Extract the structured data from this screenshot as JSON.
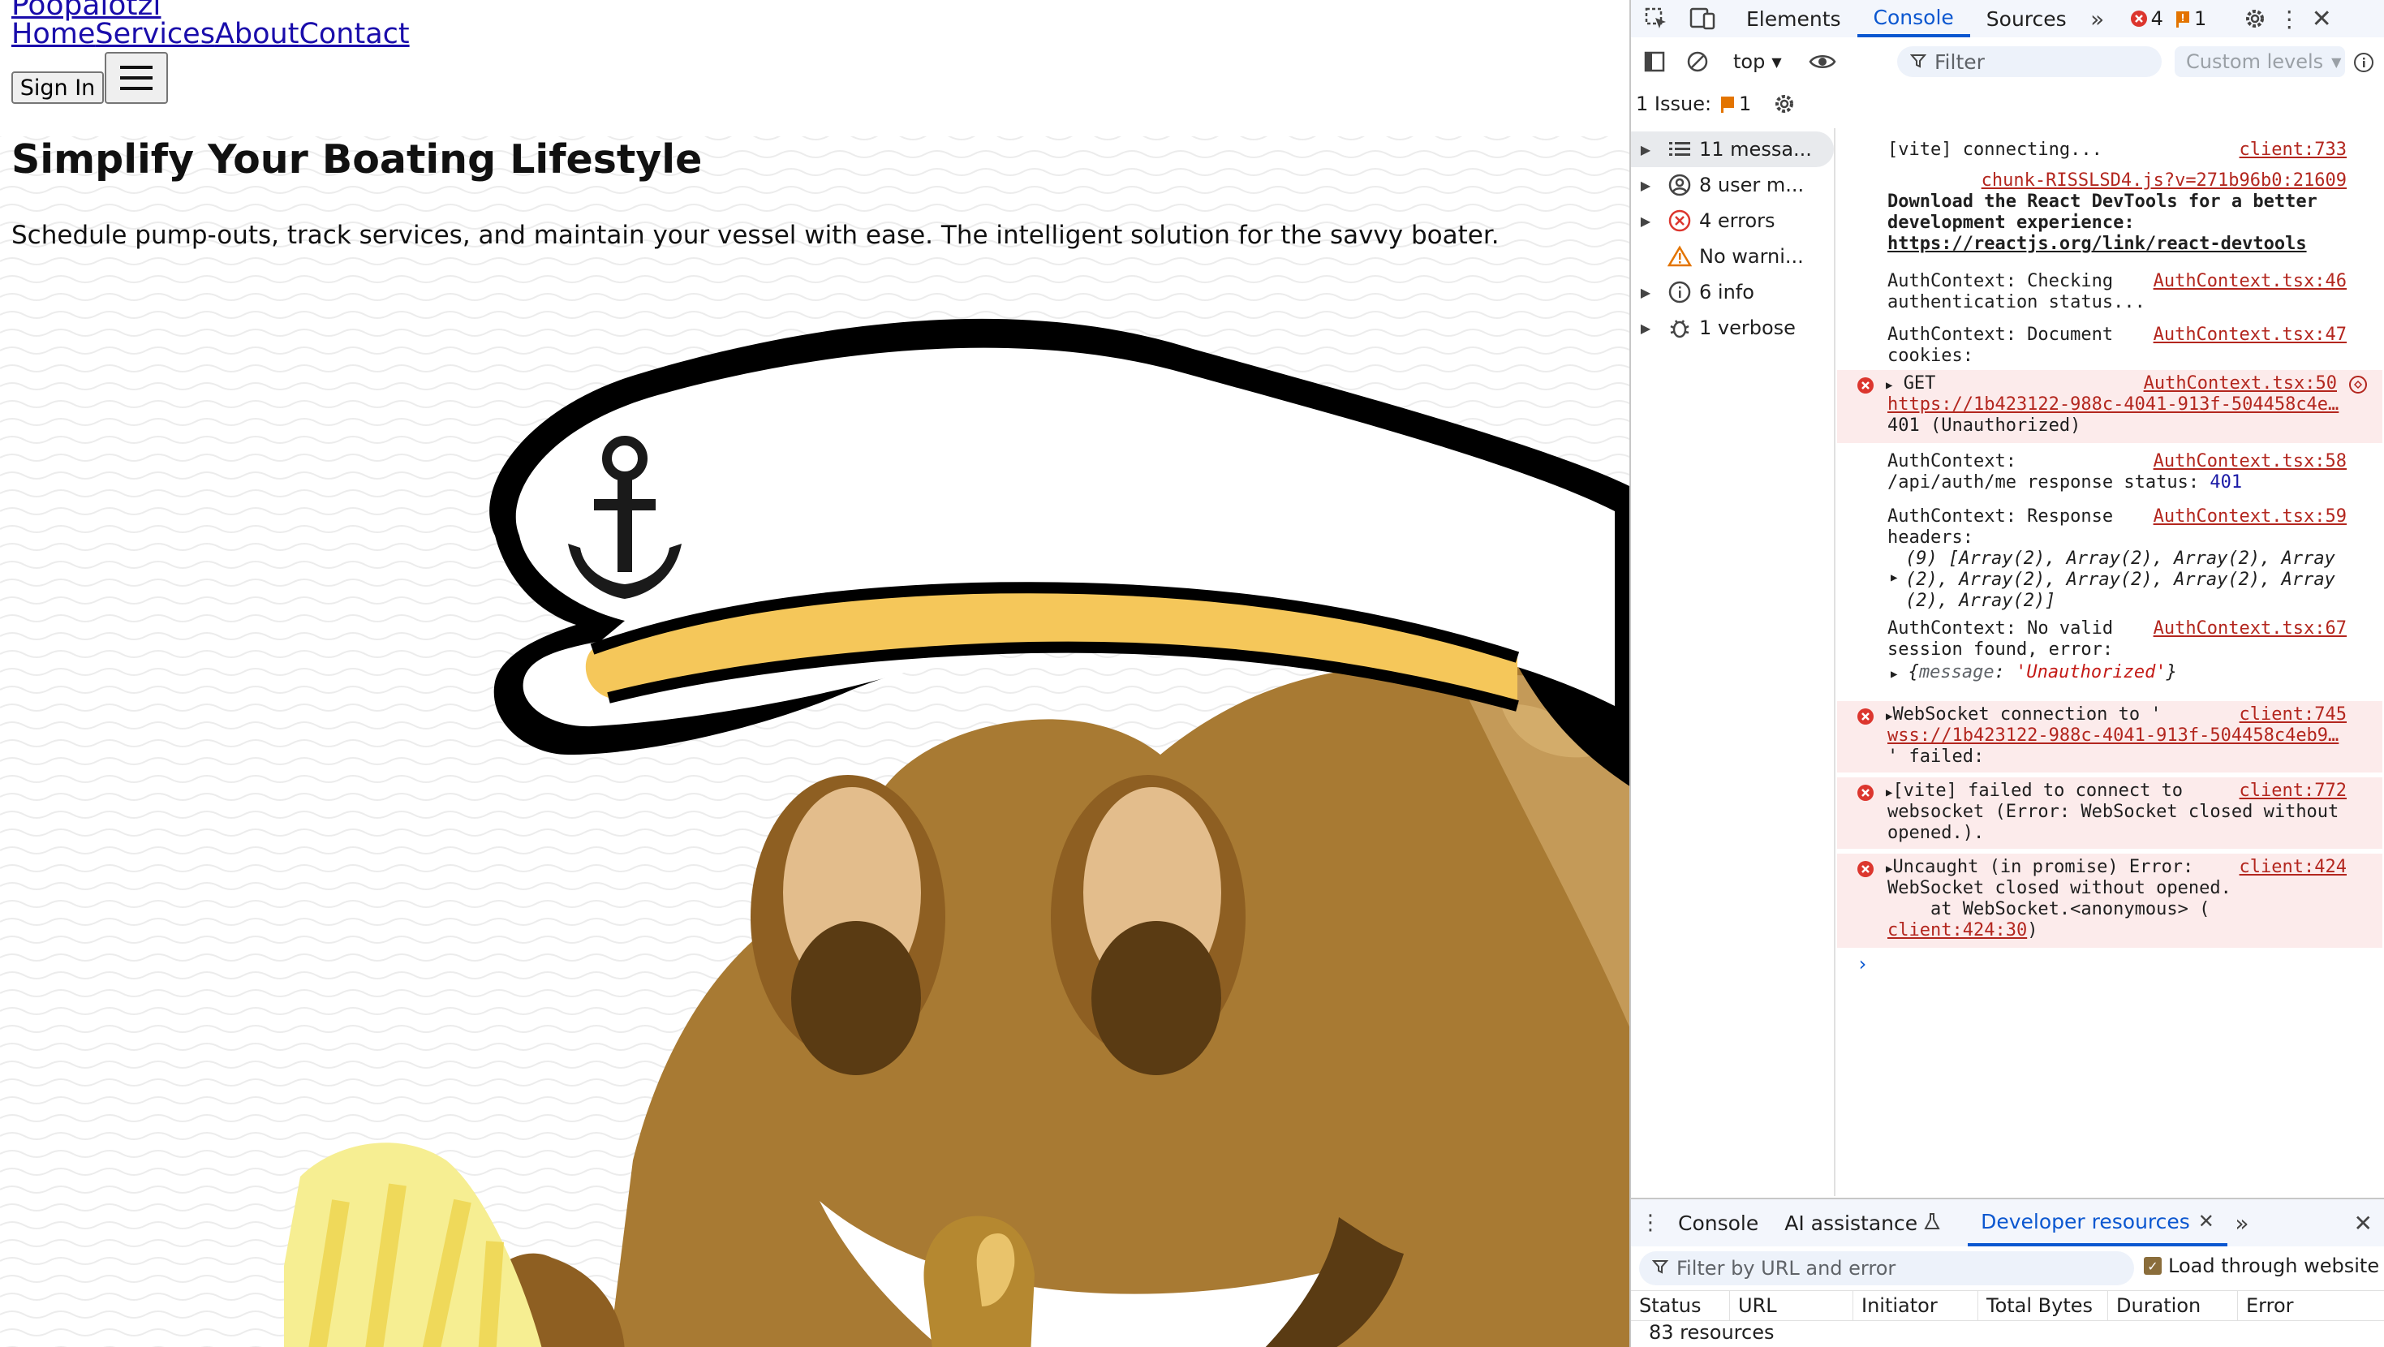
{
  "site": {
    "logo": "Poopalotzi",
    "nav": [
      "Home",
      "Services",
      "About",
      "Contact"
    ],
    "sign_in": "Sign In",
    "menu_icon": "hamburger-icon",
    "hero_title": "Simplify Your Boating Lifestyle",
    "hero_subtitle": "Schedule pump-outs, track services, and maintain your vessel with ease. The intelligent solution for the savvy boater."
  },
  "devtools": {
    "tabs": [
      "Elements",
      "Console",
      "Sources"
    ],
    "active_tab": "Console",
    "error_count": "4",
    "warning_count": "1",
    "context": "top",
    "filter_placeholder": "Filter",
    "levels": "Custom levels",
    "issues_label": "1 Issue:",
    "issues_count": "1",
    "sidebar": [
      {
        "label": "11 messa...",
        "icon": "list-icon"
      },
      {
        "label": "8 user m...",
        "icon": "user-icon"
      },
      {
        "label": "4 errors",
        "icon": "error-icon"
      },
      {
        "label": "No warni...",
        "icon": "warning-icon"
      },
      {
        "label": "6 info",
        "icon": "info-icon"
      },
      {
        "label": "1 verbose",
        "icon": "bug-icon"
      }
    ],
    "messages": {
      "m1": {
        "text": "[vite] connecting...",
        "src": "client:733"
      },
      "m2": {
        "src": "chunk-RISSLSD4.js?v=271b96b0:21609",
        "line1": "Download the React DevTools for a better",
        "line2": "development experience:",
        "link": "https://reactjs.org/link/react-devtools"
      },
      "m3": {
        "line1": "AuthContext: Checking",
        "line2": "authentication status...",
        "src": "AuthContext.tsx:46"
      },
      "m4": {
        "line1": "AuthContext: Document",
        "line2": "cookies:",
        "src": "AuthContext.tsx:47"
      },
      "m5": {
        "line1": "GET",
        "link": "https://1b423122-988c-4041-913f-504458c4e…",
        "line3": "401 (Unauthorized)",
        "src": "AuthContext.tsx:50"
      },
      "m6": {
        "line1": "AuthContext:",
        "line2": "/api/auth/me response status:",
        "status": "401",
        "src": "AuthContext.tsx:58"
      },
      "m7": {
        "line1": "AuthContext: Response",
        "line2": "headers:",
        "line3": "(9) [Array(2), Array(2), Array(2), Array",
        "line4": "(2), Array(2), Array(2), Array(2), Array",
        "line5": "(2), Array(2)]",
        "src": "AuthContext.tsx:59"
      },
      "m8": {
        "line1": "AuthContext: No valid",
        "line2": "session found, error:",
        "obj_key": "message",
        "obj_val": "'Unauthorized'",
        "src": "AuthContext.tsx:67"
      },
      "m9": {
        "line1": "WebSocket connection to '",
        "link": "wss://1b423122-988c-4041-913f-504458c4eb9…",
        "line3": "' failed:",
        "src": "client:745"
      },
      "m10": {
        "line1": "[vite] failed to connect to",
        "line2": "websocket (Error: WebSocket closed without",
        "line3": "opened.).",
        "src": "client:772"
      },
      "m11": {
        "line1": "Uncaught (in promise) Error:",
        "line2": "WebSocket closed without opened.",
        "line3": "    at WebSocket.<anonymous> (",
        "link": "client:424:30",
        "line4": ")",
        "src": "client:424"
      }
    },
    "drawer": {
      "tabs": [
        "Console",
        "AI assistance",
        "Developer resources"
      ],
      "active_tab": "Developer resources",
      "filter_placeholder": "Filter by URL and error",
      "load_through": "Load through website",
      "columns": [
        "Status",
        "URL",
        "Initiator",
        "Total Bytes",
        "Duration",
        "Error"
      ],
      "resources_count": "83 resources"
    }
  }
}
